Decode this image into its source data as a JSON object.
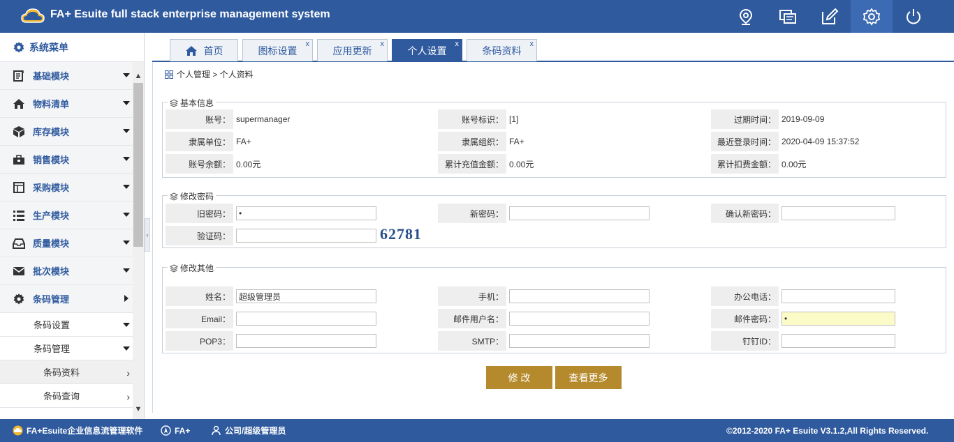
{
  "header": {
    "title": "FA+ Esuite full stack enterprise management system",
    "icons": [
      "location-icon",
      "message-icon",
      "edit-icon",
      "settings-icon",
      "power-icon"
    ]
  },
  "sidebar": {
    "title": "系统菜单",
    "items": [
      {
        "label": "基础模块",
        "icon": "clipboard-icon"
      },
      {
        "label": "物料清单",
        "icon": "home-icon"
      },
      {
        "label": "库存模块",
        "icon": "box-icon"
      },
      {
        "label": "销售模块",
        "icon": "toolbox-icon"
      },
      {
        "label": "采购模块",
        "icon": "form-icon"
      },
      {
        "label": "生产模块",
        "icon": "list-icon"
      },
      {
        "label": "质量模块",
        "icon": "inbox-icon"
      },
      {
        "label": "批次模块",
        "icon": "envelope-icon"
      },
      {
        "label": "条码管理",
        "icon": "gear-icon"
      }
    ],
    "sub": [
      {
        "label": "条码设置"
      },
      {
        "label": "条码管理"
      }
    ],
    "sub2": [
      {
        "label": "条码资料"
      },
      {
        "label": "条码查询"
      }
    ]
  },
  "tabs": [
    {
      "label": "首页",
      "closable": false
    },
    {
      "label": "图标设置",
      "closable": true
    },
    {
      "label": "应用更新",
      "closable": true
    },
    {
      "label": "个人设置",
      "closable": true,
      "active": true
    },
    {
      "label": "条码资料",
      "closable": true
    }
  ],
  "tab_close": "x",
  "breadcrumb": "个人管理 > 个人资料",
  "basic_info": {
    "legend": "基本信息",
    "rows": [
      [
        {
          "label": "账号：",
          "value": "supermanager"
        },
        {
          "label": "账号标识：",
          "value": "[1]"
        },
        {
          "label": "过期时间：",
          "value": "2019-09-09"
        }
      ],
      [
        {
          "label": "隶属单位：",
          "value": "FA+"
        },
        {
          "label": "隶属组织：",
          "value": "FA+"
        },
        {
          "label": "最近登录时间：",
          "value": "2020-04-09 15:37:52"
        }
      ],
      [
        {
          "label": "账号余额：",
          "value": "0.00元"
        },
        {
          "label": "累计充值金额：",
          "value": "0.00元"
        },
        {
          "label": "累计扣费金额：",
          "value": "0.00元"
        }
      ]
    ]
  },
  "password": {
    "legend": "修改密码",
    "old_label": "旧密码：",
    "old_value": "•",
    "new_label": "新密码：",
    "new_value": "",
    "confirm_label": "确认新密码：",
    "confirm_value": "",
    "captcha_label": "验证码：",
    "captcha_value": "",
    "captcha_code": "62781"
  },
  "other": {
    "legend": "修改其他",
    "name_label": "姓名：",
    "name_value": "超级管理员",
    "mobile_label": "手机：",
    "mobile_value": "",
    "phone_label": "办公电话：",
    "phone_value": "",
    "email_label": "Email：",
    "email_value": "",
    "mailuser_label": "邮件用户名：",
    "mailuser_value": "",
    "mailpass_label": "邮件密码：",
    "mailpass_value": "•",
    "pop3_label": "POP3：",
    "pop3_value": "",
    "smtp_label": "SMTP：",
    "smtp_value": "",
    "dingding_label": "钉钉ID：",
    "dingding_value": ""
  },
  "buttons": {
    "modify": "修 改",
    "more": "查看更多"
  },
  "footer": {
    "product": "FA+Esuite企业信息流管理软件",
    "org": "FA+",
    "user": "公司/超级管理员",
    "copyright": "©2012-2020 FA+ Esuite V3.1.2,All Rights Reserved."
  },
  "colors": {
    "primary": "#2f5a9e",
    "button": "#b58a2c",
    "highlight_input": "#fbfbc8"
  }
}
